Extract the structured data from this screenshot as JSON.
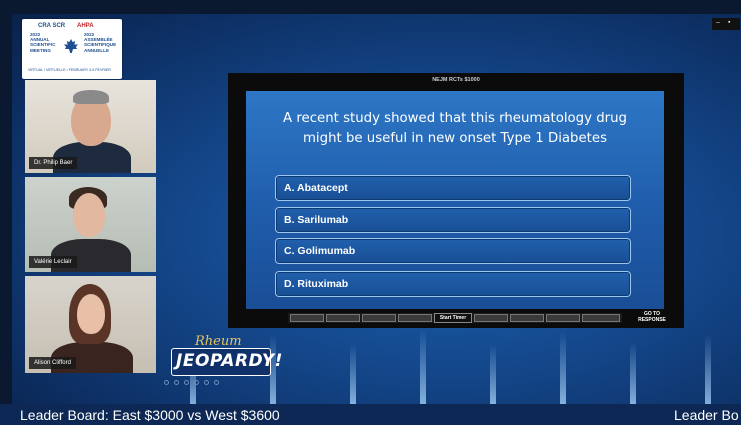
{
  "conference": {
    "org_left": "CRA SCR",
    "org_right": "AHPA",
    "left_lines": [
      "2022",
      "ANNUAL",
      "SCIENTIFIC",
      "MEETING"
    ],
    "right_lines": [
      "2022",
      "ASSEMBLÉE",
      "SCIENTIFIQUE",
      "ANNUELLE"
    ],
    "footer": "VIRTUAL / VIRTUELLE • FEBRUARY 3-5 FÉVRIER"
  },
  "participants": [
    {
      "name": "Dr. Philip Baer"
    },
    {
      "name": "Valérie Leclair"
    },
    {
      "name": "Alison Clifford"
    }
  ],
  "game": {
    "header": "NEJM RCTs $1000",
    "question": "A recent study showed that this rheumatology drug might be useful in new onset Type 1 Diabetes",
    "answers": [
      {
        "label": "A. Abatacept"
      },
      {
        "label": "B. Sarilumab"
      },
      {
        "label": "C. Golimumab"
      },
      {
        "label": "D. Rituximab"
      }
    ],
    "start_timer": "Start Timer",
    "goto_line1": "GO TO",
    "goto_line2": "RESPONSE"
  },
  "branding": {
    "rheum": "Rheum",
    "jeopardy": "JEOPARDY!"
  },
  "leaderboard": {
    "main": "Leader Board: East $3000 vs West $3600",
    "right": "Leader Bo"
  }
}
